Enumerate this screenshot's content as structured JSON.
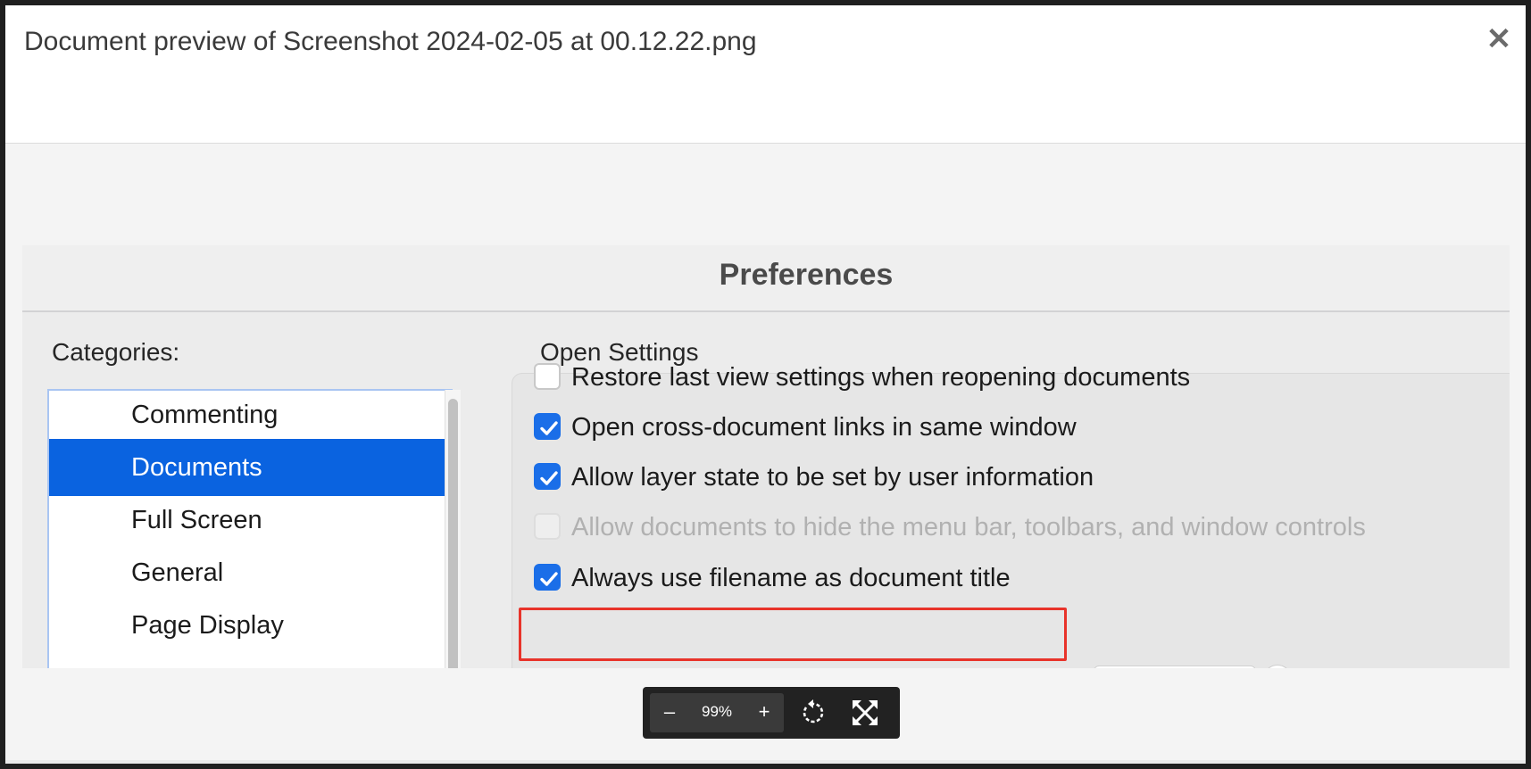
{
  "modal": {
    "title": "Document preview of Screenshot 2024-02-05 at 00.12.22.png",
    "close_icon": "close-icon"
  },
  "preferences": {
    "title": "Preferences",
    "categories_label": "Categories:",
    "categories": [
      {
        "label": "Commenting",
        "selected": false
      },
      {
        "label": "Documents",
        "selected": true
      },
      {
        "label": "Full Screen",
        "selected": false
      },
      {
        "label": "General",
        "selected": false
      },
      {
        "label": "Page Display",
        "selected": false
      }
    ],
    "open_settings_label": "Open Settings",
    "options": [
      {
        "label": "Restore last view settings when reopening documents",
        "checked": false,
        "disabled": false
      },
      {
        "label": "Open cross-document links in same window",
        "checked": true,
        "disabled": false
      },
      {
        "label": "Allow layer state to be set by user information",
        "checked": true,
        "disabled": false
      },
      {
        "label": "Allow documents to hide the menu bar, toolbars, and window controls",
        "checked": false,
        "disabled": true
      },
      {
        "label": "Always use filename as document title",
        "checked": true,
        "disabled": false,
        "highlighted": true
      }
    ]
  },
  "toolbar": {
    "zoom_out_label": "–",
    "zoom_value": "99%",
    "zoom_in_label": "+",
    "rotate_icon": "rotate-icon",
    "fullscreen_icon": "fullscreen-icon"
  },
  "colors": {
    "selection": "#0a63e0",
    "checkbox_on": "#1a6ee8",
    "highlight": "#e8332a"
  }
}
